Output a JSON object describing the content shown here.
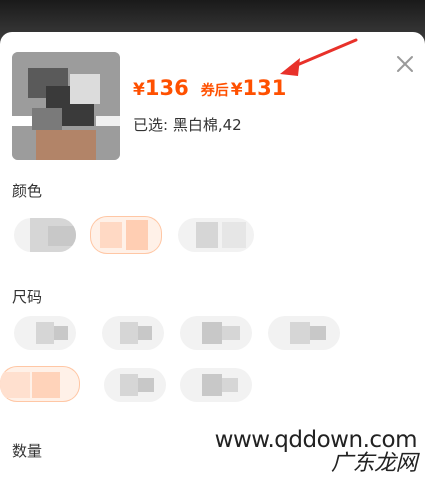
{
  "product": {
    "price_symbol": "¥",
    "price": "136",
    "coupon_label": "券后",
    "coupon_symbol": "¥",
    "coupon_price": "131",
    "selected_text": "已选: 黑白棉,42"
  },
  "sections": {
    "color_title": "颜色",
    "size_title": "尺码",
    "quantity_title": "数量"
  },
  "icons": {
    "close": "close-icon",
    "arrow": "arrow-annotation"
  },
  "colors": {
    "accent": "#ff5000",
    "arrow": "#e8312a",
    "active_option_bg": "#fff1e8"
  },
  "watermark": {
    "line1": "www.qddown.com",
    "line2": "广东龙网"
  }
}
